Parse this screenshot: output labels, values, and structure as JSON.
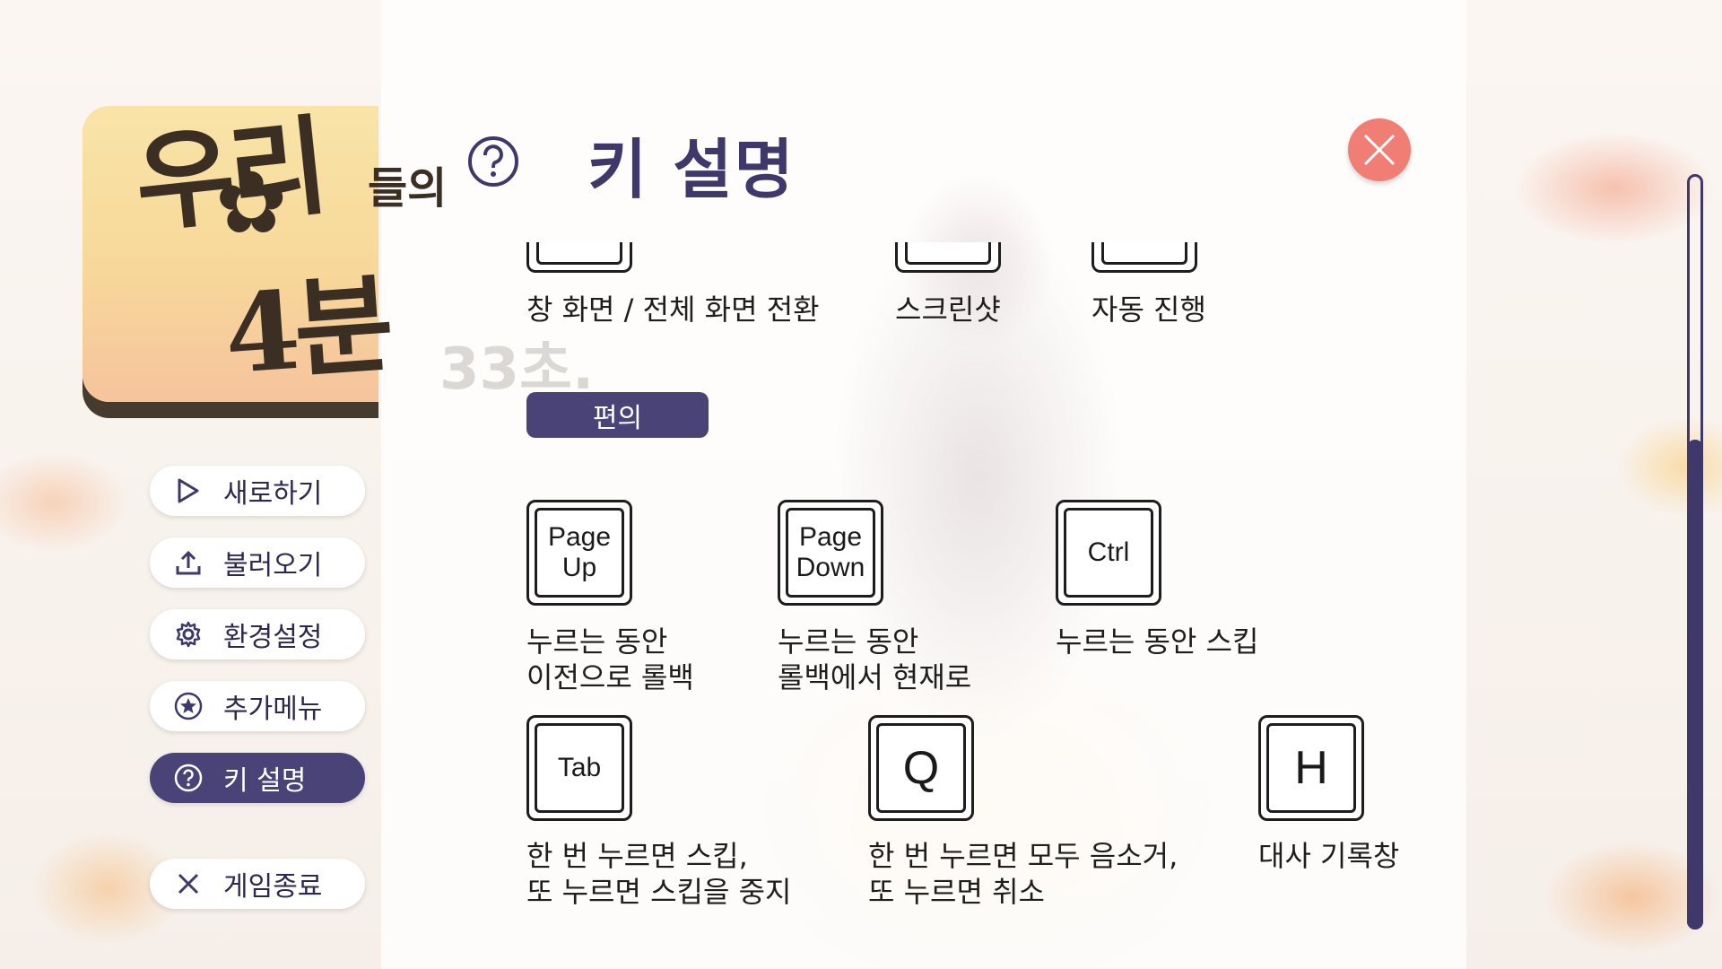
{
  "logo": {
    "line1": "우리",
    "line1_small": "들의",
    "line2": "4분",
    "sub": "33초."
  },
  "menu": {
    "items": [
      {
        "label": "새로하기",
        "icon": "play-icon"
      },
      {
        "label": "불러오기",
        "icon": "upload-icon"
      },
      {
        "label": "환경설정",
        "icon": "gear-icon"
      },
      {
        "label": "추가메뉴",
        "icon": "star-icon"
      },
      {
        "label": "키 설명",
        "icon": "help-icon",
        "active": true
      },
      {
        "label": "게임종료",
        "icon": "close-icon"
      }
    ]
  },
  "panel": {
    "title": "키 설명",
    "top_row": [
      {
        "desc": "창 화면 / 전체 화면 전환"
      },
      {
        "desc": "스크린샷"
      },
      {
        "desc": "자동 진행"
      }
    ],
    "section": "편의",
    "keys_row1": [
      {
        "key": "Page\nUp",
        "desc": "누르는 동안\n이전으로 롤백"
      },
      {
        "key": "Page\nDown",
        "desc": "누르는 동안\n롤백에서 현재로"
      },
      {
        "key": "Ctrl",
        "desc": "누르는 동안 스킵"
      }
    ],
    "keys_row2": [
      {
        "key": "Tab",
        "desc": "한 번 누르면 스킵,\n또 누르면 스킵을 중지"
      },
      {
        "key": "Q",
        "desc": "한 번 누르면 모두 음소거,\n또 누르면 취소"
      },
      {
        "key": "H",
        "desc": "대사 기록창"
      }
    ]
  },
  "colors": {
    "accent": "#4a4377",
    "title": "#3e386b",
    "close": "#f07e74"
  }
}
